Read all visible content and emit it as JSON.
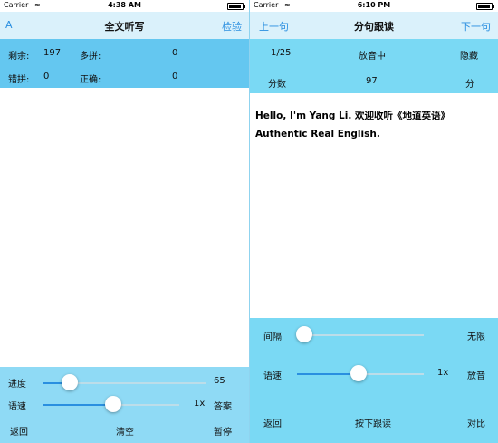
{
  "left": {
    "status": {
      "carrier": "Carrier",
      "wifi": "≈",
      "time": "4:38 AM"
    },
    "nav": {
      "left": "A",
      "title": "全文听写",
      "right": "检验"
    },
    "stats": {
      "remaining_label": "剩余:",
      "remaining_value": "197",
      "extra_label": "多拼:",
      "extra_value": "0",
      "wrong_label": "错拼:",
      "wrong_value": "0",
      "correct_label": "正确:",
      "correct_value": "0"
    },
    "progress": {
      "label": "进度",
      "value": "65"
    },
    "speed": {
      "label": "语速",
      "value": "1x",
      "answer": "答案"
    },
    "bottom": {
      "back": "返回",
      "clear": "清空",
      "pause": "暂停"
    }
  },
  "right": {
    "status": {
      "carrier": "Carrier",
      "wifi": "≈",
      "time": "6:10 PM"
    },
    "nav": {
      "left": "上一句",
      "title": "分句跟读",
      "right": "下一句"
    },
    "info": {
      "count": "1/25",
      "playing": "放音中",
      "hide": "隐藏",
      "score_label": "分数",
      "score": "97",
      "unit": "分"
    },
    "sentence": "Hello, I'm Yang Li. 欢迎收听《地道英语》Authentic Real English.",
    "interval": {
      "label": "间隔",
      "value": "无限"
    },
    "speed": {
      "label": "语速",
      "value": "1x",
      "play": "放音"
    },
    "bottom": {
      "back": "返回",
      "hold": "按下跟读",
      "compare": "对比"
    }
  },
  "colors": {
    "nav_bg": "#daf1fb",
    "panel_blue": "#64c7f0",
    "bottom_blue": "#8fdaf5",
    "right_panel": "#7ad9f4",
    "accent": "#2a8fe0"
  }
}
